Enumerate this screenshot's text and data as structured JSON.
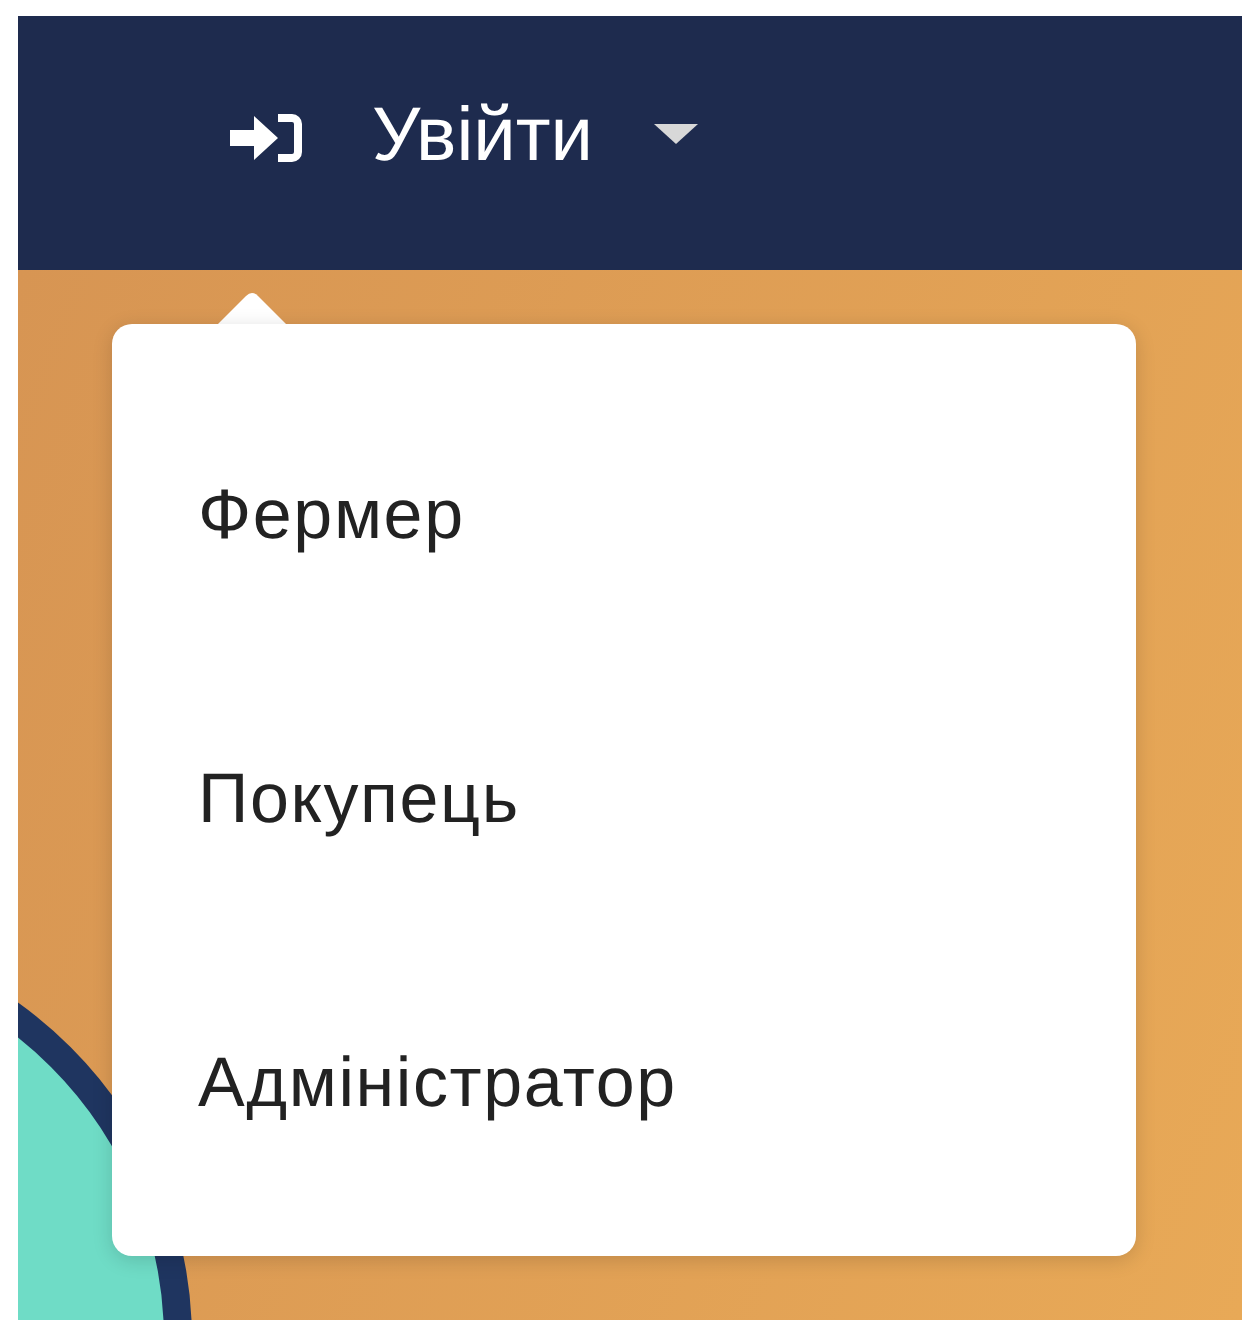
{
  "login": {
    "label": "Увійти",
    "expanded": true
  },
  "menu": {
    "items": [
      {
        "label": "Фермер"
      },
      {
        "label": "Покупець"
      },
      {
        "label": "Адміністратор"
      }
    ]
  }
}
